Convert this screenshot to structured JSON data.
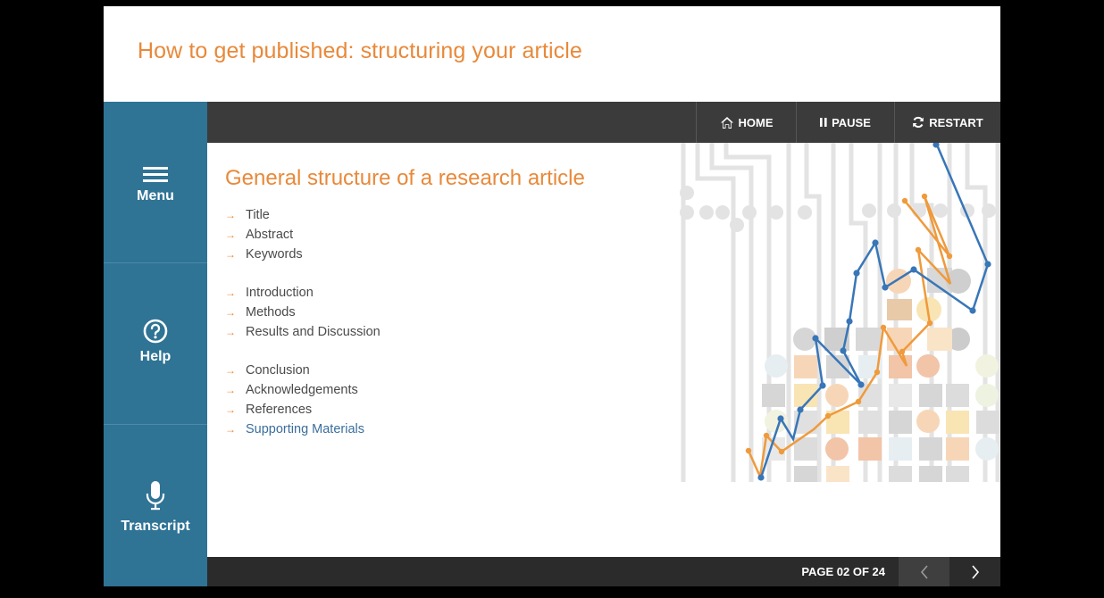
{
  "course_title": "How to get published: structuring your article",
  "sidebar": {
    "items": [
      {
        "label": "Menu",
        "icon": "menu-icon"
      },
      {
        "label": "Help",
        "icon": "help-icon"
      },
      {
        "label": "Transcript",
        "icon": "microphone-icon"
      }
    ]
  },
  "toolbar": {
    "home_label": "HOME",
    "pause_label": "PAUSE",
    "restart_label": "RESTART"
  },
  "slide": {
    "title": "General structure of a research article",
    "groups": [
      [
        "Title",
        "Abstract",
        "Keywords"
      ],
      [
        "Introduction",
        "Methods",
        "Results and Discussion"
      ],
      [
        "Conclusion",
        "Acknowledgements",
        "References",
        "Supporting Materials"
      ]
    ],
    "highlighted_item": "Supporting Materials"
  },
  "footer": {
    "page_indicator": "PAGE 02 OF 24"
  },
  "colors": {
    "accent_orange": "#e8893a",
    "sidebar_blue": "#2f7395",
    "toolbar_dark": "#3b3b3b",
    "link_blue": "#3a6e9c"
  }
}
